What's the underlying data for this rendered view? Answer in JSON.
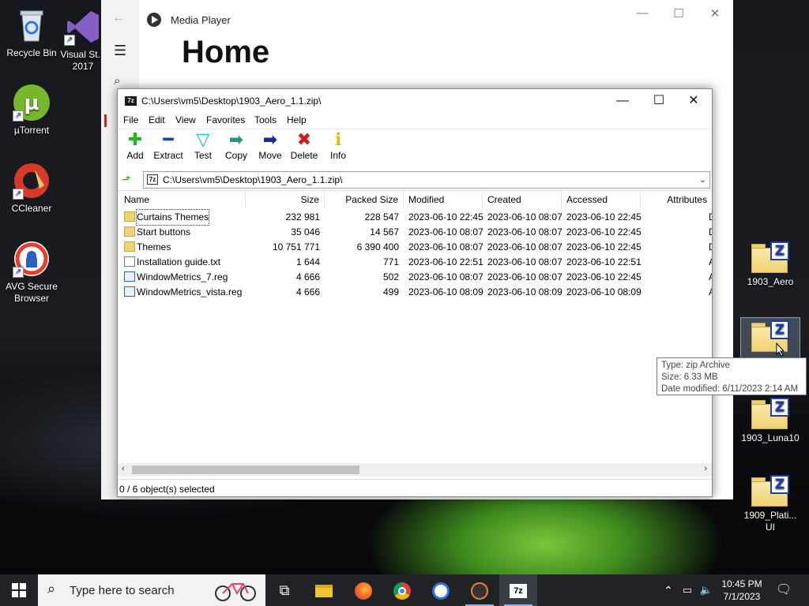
{
  "desktop": {
    "left_icons": [
      {
        "label": "Recycle Bin",
        "icon": "recycle-bin-icon"
      },
      {
        "label": "Visual St... 2017",
        "icon": "visual-studio-icon"
      },
      {
        "label": "µTorrent",
        "icon": "utorrent-icon"
      },
      {
        "label": "CCleaner",
        "icon": "ccleaner-icon"
      },
      {
        "label": "AVG Secure Browser",
        "icon": "avg-browser-icon"
      }
    ],
    "right_icons": [
      {
        "label": "1903_Aero",
        "icon": "zip-folder-icon"
      },
      {
        "label": "",
        "icon": "zip-folder-icon"
      },
      {
        "label": "1903_Luna10",
        "icon": "zip-folder-icon"
      },
      {
        "label": "1909_Plati... UI",
        "icon": "zip-folder-icon"
      }
    ]
  },
  "media_player": {
    "title": "Media Player",
    "heading": "Home"
  },
  "zip_window": {
    "title": "C:\\Users\\vm5\\Desktop\\1903_Aero_1.1.zip\\",
    "menu": [
      "File",
      "Edit",
      "View",
      "Favorites",
      "Tools",
      "Help"
    ],
    "toolbar": [
      {
        "label": "Add",
        "icon": "add-icon",
        "color": "#22b822"
      },
      {
        "label": "Extract",
        "icon": "extract-icon",
        "color": "#1a3fbf"
      },
      {
        "label": "Test",
        "icon": "test-icon",
        "color": "#1fb7c7"
      },
      {
        "label": "Copy",
        "icon": "copy-icon",
        "color": "#1e9c7c"
      },
      {
        "label": "Move",
        "icon": "move-icon",
        "color": "#1a2b8f"
      },
      {
        "label": "Delete",
        "icon": "delete-icon",
        "color": "#d21a1a"
      },
      {
        "label": "Info",
        "icon": "info-icon",
        "color": "#d8c21a"
      }
    ],
    "address": "C:\\Users\\vm5\\Desktop\\1903_Aero_1.1.zip\\",
    "columns": [
      "Name",
      "Size",
      "Packed Size",
      "Modified",
      "Created",
      "Accessed",
      "Attributes"
    ],
    "rows": [
      {
        "name": "Curtains Themes",
        "type": "folder",
        "size": "232 981",
        "packed": "228 547",
        "modified": "2023-06-10 22:45",
        "created": "2023-06-10 08:07",
        "accessed": "2023-06-10 22:45",
        "attr": "D"
      },
      {
        "name": "Start buttons",
        "type": "folder",
        "size": "35 046",
        "packed": "14 567",
        "modified": "2023-06-10 08:07",
        "created": "2023-06-10 08:07",
        "accessed": "2023-06-10 22:45",
        "attr": "D"
      },
      {
        "name": "Themes",
        "type": "folder",
        "size": "10 751 771",
        "packed": "6 390 400",
        "modified": "2023-06-10 08:07",
        "created": "2023-06-10 08:07",
        "accessed": "2023-06-10 22:45",
        "attr": "D"
      },
      {
        "name": "Installation guide.txt",
        "type": "txt",
        "size": "1 644",
        "packed": "771",
        "modified": "2023-06-10 22:51",
        "created": "2023-06-10 08:07",
        "accessed": "2023-06-10 22:51",
        "attr": "A"
      },
      {
        "name": "WindowMetrics_7.reg",
        "type": "reg",
        "size": "4 666",
        "packed": "502",
        "modified": "2023-06-10 08:07",
        "created": "2023-06-10 08:07",
        "accessed": "2023-06-10 22:45",
        "attr": "A"
      },
      {
        "name": "WindowMetrics_vista.reg",
        "type": "reg",
        "size": "4 666",
        "packed": "499",
        "modified": "2023-06-10 08:09",
        "created": "2023-06-10 08:09",
        "accessed": "2023-06-10 08:09",
        "attr": "A"
      }
    ],
    "status": "0 / 6 object(s) selected"
  },
  "tooltip": {
    "type": "Type: zip Archive",
    "size": "Size: 6.33 MB",
    "date": "Date modified: 6/11/2023 2:14 AM"
  },
  "taskbar": {
    "search_placeholder": "Type here to search",
    "time": "10:45 PM",
    "date": "7/1/2023"
  }
}
